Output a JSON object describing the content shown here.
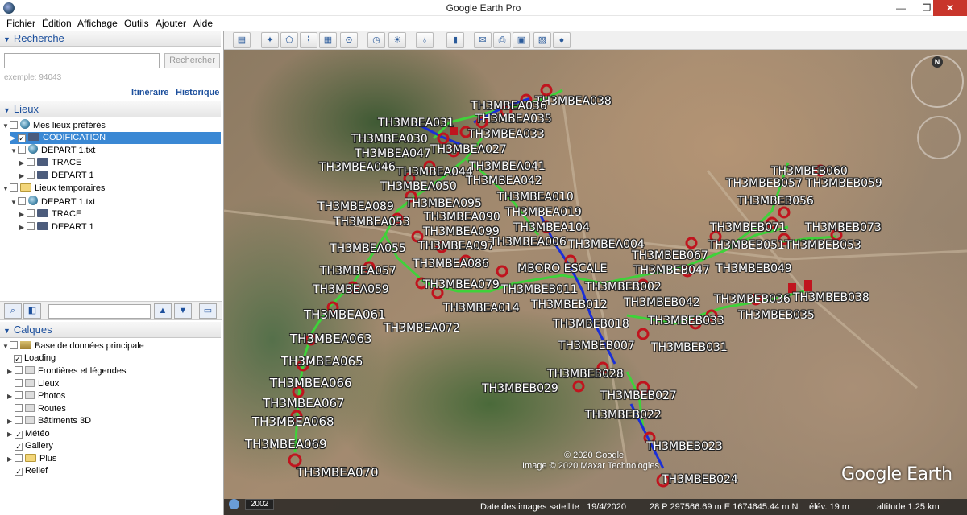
{
  "window": {
    "title": "Google Earth Pro"
  },
  "menu": [
    "Fichier",
    "Édition",
    "Affichage",
    "Outils",
    "Ajouter",
    "Aide"
  ],
  "search": {
    "header": "Recherche",
    "button": "Rechercher",
    "placeholder": "",
    "example": "exemple: 94043",
    "link_itinerary": "Itinéraire",
    "link_history": "Historique"
  },
  "places": {
    "header": "Lieux",
    "items": [
      {
        "label": "Mes lieux préférés",
        "checked": ""
      },
      {
        "label": "CODIFICATION",
        "checked": "✓"
      },
      {
        "label": "DEPART 1.txt",
        "checked": ""
      },
      {
        "label": "TRACE",
        "checked": ""
      },
      {
        "label": "DEPART 1",
        "checked": ""
      },
      {
        "label": "Lieux temporaires",
        "checked": ""
      },
      {
        "label": "DEPART 1.txt",
        "checked": ""
      },
      {
        "label": "TRACE",
        "checked": ""
      },
      {
        "label": "DEPART 1",
        "checked": ""
      }
    ]
  },
  "layers": {
    "header": "Calques",
    "items": [
      {
        "label": "Base de données principale",
        "checked": ""
      },
      {
        "label": "Loading",
        "checked": "✓"
      },
      {
        "label": "Frontières et légendes",
        "checked": ""
      },
      {
        "label": "Lieux",
        "checked": ""
      },
      {
        "label": "Photos",
        "checked": ""
      },
      {
        "label": "Routes",
        "checked": ""
      },
      {
        "label": "Bâtiments 3D",
        "checked": ""
      },
      {
        "label": "Météo",
        "checked": "✓"
      },
      {
        "label": "Gallery",
        "checked": "✓"
      },
      {
        "label": "Plus",
        "checked": ""
      },
      {
        "label": "Relief",
        "checked": "✓"
      }
    ]
  },
  "map": {
    "labels": [
      "TH3MBEA038",
      "TH3MBEA036",
      "TH3MBEA035",
      "TH3MBEA031",
      "TH3MBEA033",
      "TH3MBEA030",
      "TH3MBEA047",
      "TH3MBEA027",
      "TH3MBEA046",
      "TH3MBEA044",
      "TH3MBEA041",
      "TH3MBEA042",
      "TH3MBEA050",
      "TH3MBEA010",
      "TH3MBEA095",
      "TH3MBEA089",
      "TH3MBEA090",
      "TH3MBEA019",
      "TH3MBEA053",
      "TH3MBEA104",
      "TH3MBEA099",
      "TH3MBEA097",
      "TH3MBEA006",
      "TH3MBEA004",
      "TH3MBEA055",
      "TH3MBEA086",
      "TH3MBEA057",
      "MBORO ESCALE",
      "TH3MBEB067",
      "TH3MBEB047",
      "TH3MBEB049",
      "TH3MBEA059",
      "TH3MBEA079",
      "TH3MBEB011",
      "TH3MBEB002",
      "TH3MBEB036",
      "TH3MBEB038",
      "TH3MBEA014",
      "TH3MBEB012",
      "TH3MBEB042",
      "TH3MBEA061",
      "TH3MBEB033",
      "TH3MBEB035",
      "TH3MBEA072",
      "TH3MBEB018",
      "TH3MBEA063",
      "TH3MBEB007",
      "TH3MBEB031",
      "TH3MBEA065",
      "TH3MBEB028",
      "TH3MBEA066",
      "TH3MBEB029",
      "TH3MBEB027",
      "TH3MBEA067",
      "TH3MBEB022",
      "TH3MBEA068",
      "TH3MBEB023",
      "TH3MBEA069",
      "TH3MBEA070",
      "TH3MBEB024",
      "TH3MBEB060",
      "TH3MBEB057",
      "TH3MBEB059",
      "TH3MBEB056",
      "TH3MBEB071",
      "TH3MBEB073",
      "TH3MBEB051",
      "TH3MBEB053"
    ],
    "logo": "Google Earth",
    "copyright_google": "© 2020 Google",
    "copyright_maxar": "Image © 2020 Maxar Technologies",
    "compass_n": "N"
  },
  "status": {
    "year": "2002",
    "date": "Date des images satellite : 19/4/2020",
    "coords": "28 P 297566.69 m E 1674645.44 m N",
    "elev": "élév.   19 m",
    "alt": "altitude   1.25 km"
  },
  "colors": {
    "selected": "#3a88d4",
    "header_text": "#1c4f9c",
    "green_line": "#3fd23a",
    "blue_line": "#1a2fd8",
    "marker": "#c0141e"
  }
}
